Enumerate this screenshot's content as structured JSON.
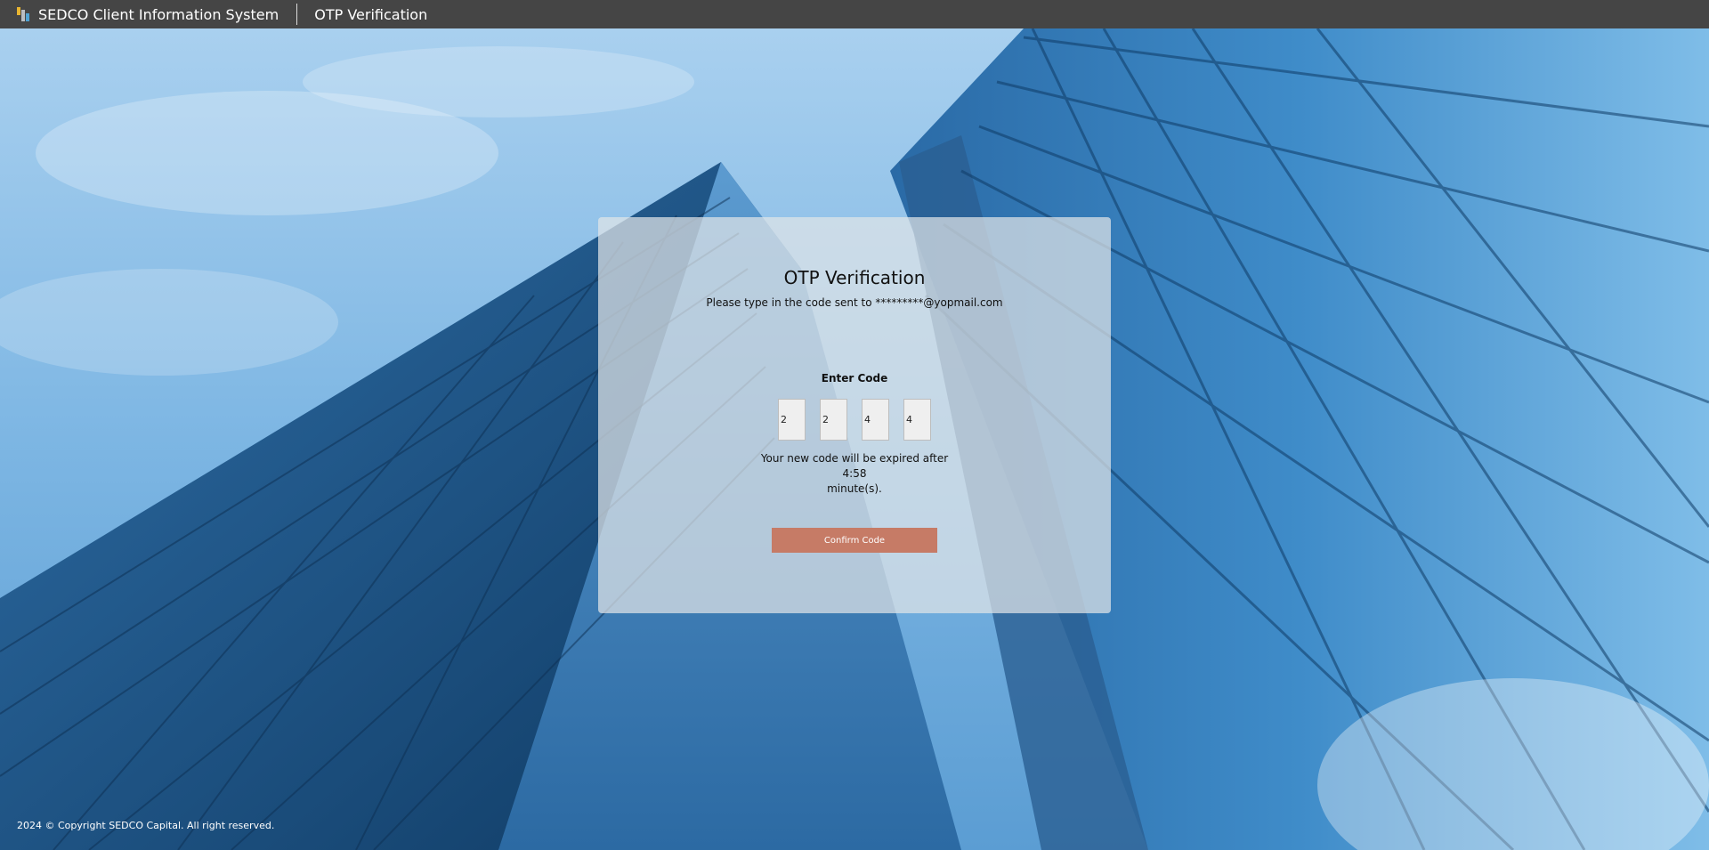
{
  "topbar": {
    "app_title": "SEDCO Client Information System",
    "page_name": "OTP Verification"
  },
  "card": {
    "title": "OTP Verification",
    "subtitle": "Please type in the code sent to *********@yopmail.com",
    "enter_code_label": "Enter Code",
    "code_digits": [
      "2",
      "2",
      "4",
      "4"
    ],
    "expire_line1": "Your new code will be expired after",
    "expire_timer": "4:58",
    "expire_line2": "minute(s).",
    "confirm_label": "Confirm Code"
  },
  "footer": {
    "copyright": "2024 © Copyright SEDCO Capital. All right reserved."
  },
  "colors": {
    "topbar": "#454545",
    "confirm_button": "#c67b66",
    "sky": "#8fc0e8",
    "glass_dark": "#1d4f7f"
  },
  "icons": {
    "app_logo": "sedco-logo-icon"
  }
}
